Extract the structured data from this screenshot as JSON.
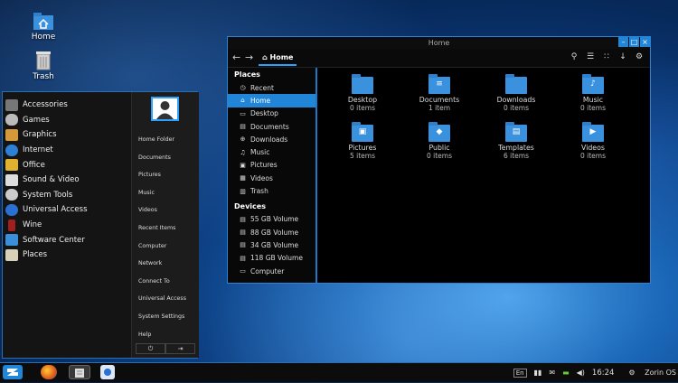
{
  "desktop": {
    "icons": [
      {
        "label": "Home"
      },
      {
        "label": "Trash"
      }
    ]
  },
  "start_menu": {
    "categories": [
      {
        "label": "Accessories",
        "color": "#888888"
      },
      {
        "label": "Games",
        "color": "#bbbbbb"
      },
      {
        "label": "Graphics",
        "color": "#d49a3a"
      },
      {
        "label": "Internet",
        "color": "#2e7fd6"
      },
      {
        "label": "Office",
        "color": "#e0b030"
      },
      {
        "label": "Sound & Video",
        "color": "#dddddd"
      },
      {
        "label": "System Tools",
        "color": "#cccccc"
      },
      {
        "label": "Universal Access",
        "color": "#2a6fd2"
      },
      {
        "label": "Wine",
        "color": "#a02020"
      },
      {
        "label": "Software Center",
        "color": "#3a8fd8"
      },
      {
        "label": "Places",
        "color": "#d8d0b8"
      }
    ],
    "places": [
      {
        "label": "Home Folder"
      },
      {
        "label": "Documents"
      },
      {
        "label": "Pictures"
      },
      {
        "label": "Music"
      },
      {
        "label": "Videos"
      },
      {
        "label": "Recent Items"
      },
      {
        "label": "Computer"
      },
      {
        "label": "Network"
      },
      {
        "label": "Connect To"
      },
      {
        "label": "Universal Access"
      },
      {
        "label": "System Settings"
      },
      {
        "label": "Help"
      }
    ],
    "power_icon": "power-icon",
    "logout_icon": "logout-icon"
  },
  "file_manager": {
    "title": "Home",
    "breadcrumb": "Home",
    "sidebar": {
      "places_header": "Places",
      "places": [
        {
          "label": "Recent",
          "icon": "clock-icon"
        },
        {
          "label": "Home",
          "icon": "home-icon",
          "selected": true
        },
        {
          "label": "Desktop",
          "icon": "desktop-icon"
        },
        {
          "label": "Documents",
          "icon": "documents-icon"
        },
        {
          "label": "Downloads",
          "icon": "downloads-icon"
        },
        {
          "label": "Music",
          "icon": "music-icon"
        },
        {
          "label": "Pictures",
          "icon": "pictures-icon"
        },
        {
          "label": "Videos",
          "icon": "videos-icon"
        },
        {
          "label": "Trash",
          "icon": "trash-icon"
        }
      ],
      "devices_header": "Devices",
      "devices": [
        {
          "label": "55 GB Volume"
        },
        {
          "label": "88 GB Volume"
        },
        {
          "label": "34 GB Volume"
        },
        {
          "label": "118 GB Volume"
        },
        {
          "label": "Computer"
        }
      ]
    },
    "items": [
      {
        "name": "Desktop",
        "count": "0 items",
        "glyph": ""
      },
      {
        "name": "Documents",
        "count": "1 item",
        "glyph": "≡"
      },
      {
        "name": "Downloads",
        "count": "0 items",
        "glyph": ""
      },
      {
        "name": "Music",
        "count": "0 items",
        "glyph": "♪"
      },
      {
        "name": "Pictures",
        "count": "5 items",
        "glyph": "▣"
      },
      {
        "name": "Public",
        "count": "0 items",
        "glyph": "◆"
      },
      {
        "name": "Templates",
        "count": "6 items",
        "glyph": "▤"
      },
      {
        "name": "Videos",
        "count": "0 items",
        "glyph": "▶"
      }
    ]
  },
  "taskbar": {
    "keyboard_layout": "En",
    "clock": "16:24",
    "os_label": "Zorin OS"
  },
  "colors": {
    "accent": "#2286d8"
  }
}
